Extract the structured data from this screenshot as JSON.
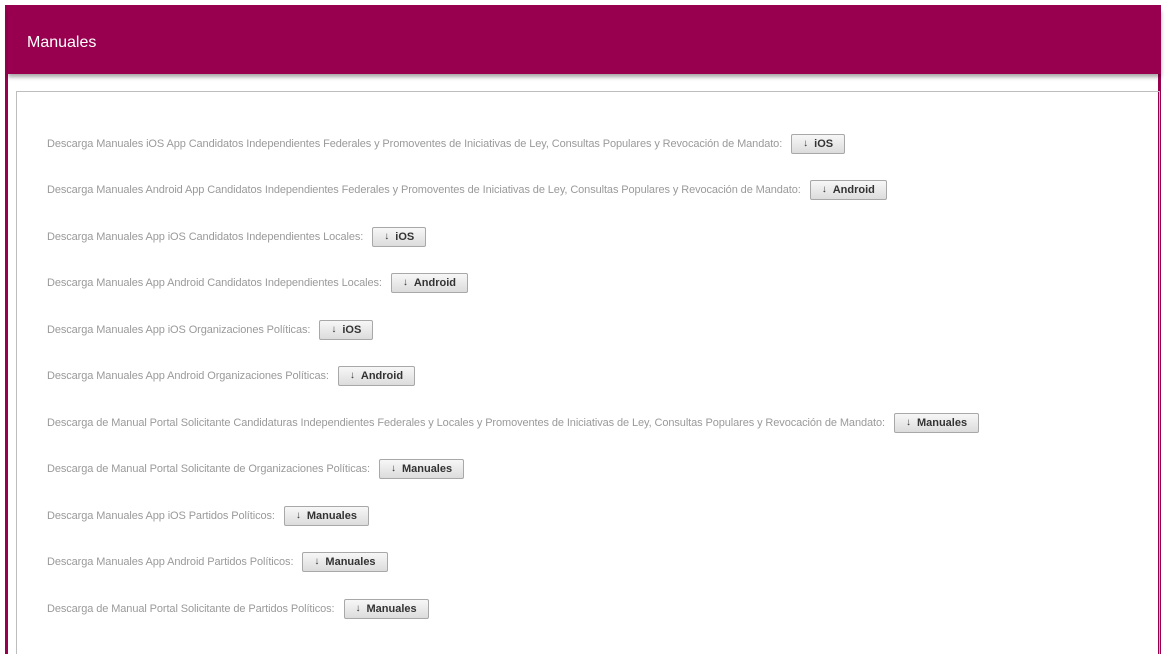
{
  "header": {
    "title": "Manuales"
  },
  "rows": [
    {
      "label": "Descarga Manuales iOS App Candidatos Independientes Federales y Promoventes de Iniciativas de Ley, Consultas Populares y Revocación de Mandato:",
      "button": "iOS"
    },
    {
      "label": "Descarga Manuales Android App Candidatos Independientes Federales y Promoventes de Iniciativas de Ley, Consultas Populares y Revocación de Mandato:",
      "button": "Android"
    },
    {
      "label": "Descarga Manuales App iOS Candidatos Independientes Locales:",
      "button": "iOS"
    },
    {
      "label": "Descarga Manuales App Android Candidatos Independientes Locales:",
      "button": "Android"
    },
    {
      "label": "Descarga Manuales App iOS Organizaciones Políticas:",
      "button": "iOS"
    },
    {
      "label": "Descarga Manuales App Android Organizaciones Políticas:",
      "button": "Android"
    },
    {
      "label": "Descarga de Manual Portal Solicitante Candidaturas Independientes Federales y Locales y Promoventes de Iniciativas de Ley, Consultas Populares y Revocación de Mandato:",
      "button": "Manuales"
    },
    {
      "label": "Descarga de Manual Portal Solicitante de Organizaciones Políticas:",
      "button": "Manuales"
    },
    {
      "label": "Descarga Manuales App iOS Partidos Políticos:",
      "button": "Manuales"
    },
    {
      "label": "Descarga Manuales App Android Partidos Políticos:",
      "button": "Manuales"
    },
    {
      "label": "Descarga de Manual Portal Solicitante de Partidos Políticos:",
      "button": "Manuales"
    }
  ],
  "icons": {
    "download": "download-arrow-icon"
  },
  "colors": {
    "brand": "#98004f",
    "label_text": "#9a9a9a",
    "button_text": "#333333"
  }
}
